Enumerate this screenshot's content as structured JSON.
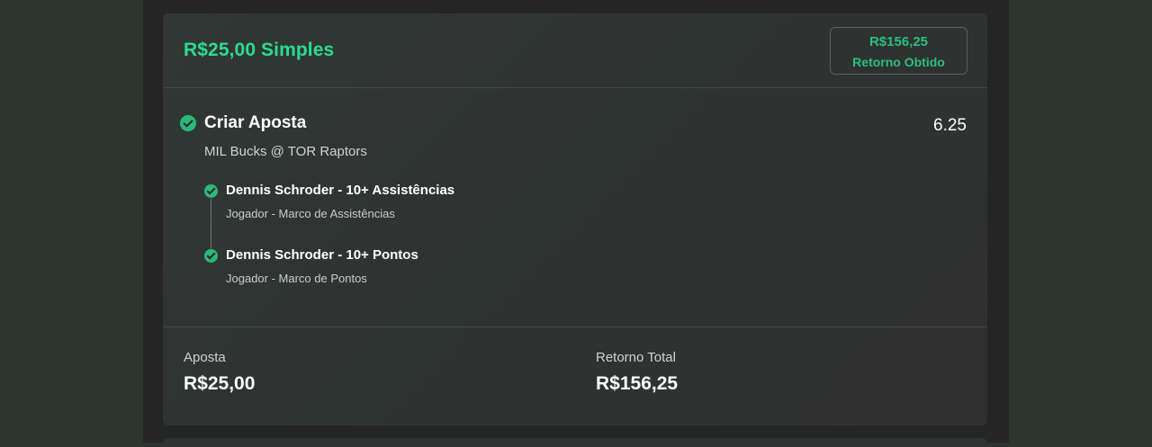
{
  "header": {
    "title": "R$25,00 Simples",
    "return_amount": "R$156,25",
    "return_label": "Retorno Obtido"
  },
  "bet": {
    "title": "Criar Aposta",
    "odds": "6.25",
    "event": "MIL Bucks @ TOR Raptors",
    "selections": [
      {
        "title": "Dennis Schroder - 10+ Assistências",
        "subtitle": "Jogador - Marco de Assistências"
      },
      {
        "title": "Dennis Schroder - 10+ Pontos",
        "subtitle": "Jogador - Marco de Pontos"
      }
    ]
  },
  "footer": {
    "stake_label": "Aposta",
    "stake_value": "R$25,00",
    "total_return_label": "Retorno Total",
    "total_return_value": "R$156,25"
  },
  "icons": {
    "status": "check-circle-icon"
  },
  "colors": {
    "accent_green": "#2bdc8f",
    "badge_green": "#2bbf7f",
    "check_green": "#2bb87a"
  }
}
